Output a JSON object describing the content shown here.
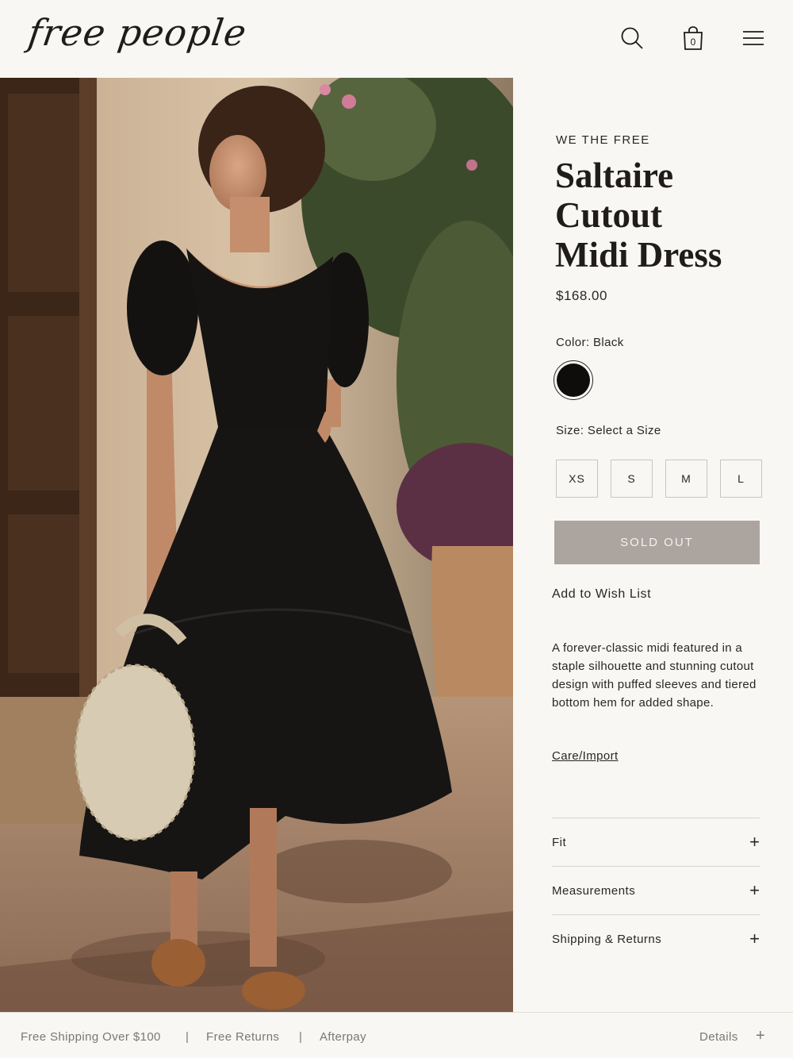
{
  "header": {
    "logo": "free people",
    "bag_count": "0"
  },
  "product": {
    "brand": "WE THE FREE",
    "title_lines": [
      "Saltaire",
      "Cutout",
      "Midi Dress"
    ],
    "price": "$168.00",
    "color_label": "Color: Black",
    "swatch_color": "#0e0d0c",
    "size_label": "Size: Select a Size",
    "sizes": [
      "XS",
      "S",
      "M",
      "L"
    ],
    "sold_out_label": "SOLD OUT",
    "wishlist_label": "Add to Wish List",
    "description": "A forever-classic midi featured in a staple silhouette and stunning cutout design with puffed sleeves and tiered bottom hem for added shape.",
    "care_link": "Care/Import",
    "accordion": [
      "Fit",
      "Measurements",
      "Shipping & Returns"
    ]
  },
  "footer": {
    "items": [
      "Free Shipping Over $100",
      "Free Returns",
      "Afterpay"
    ],
    "separator": "|",
    "details_label": "Details",
    "details_icon": "+"
  },
  "icons": {
    "search": "search-icon",
    "bag": "shopping-bag-icon",
    "menu": "hamburger-menu-icon",
    "expand": "plus-icon"
  }
}
